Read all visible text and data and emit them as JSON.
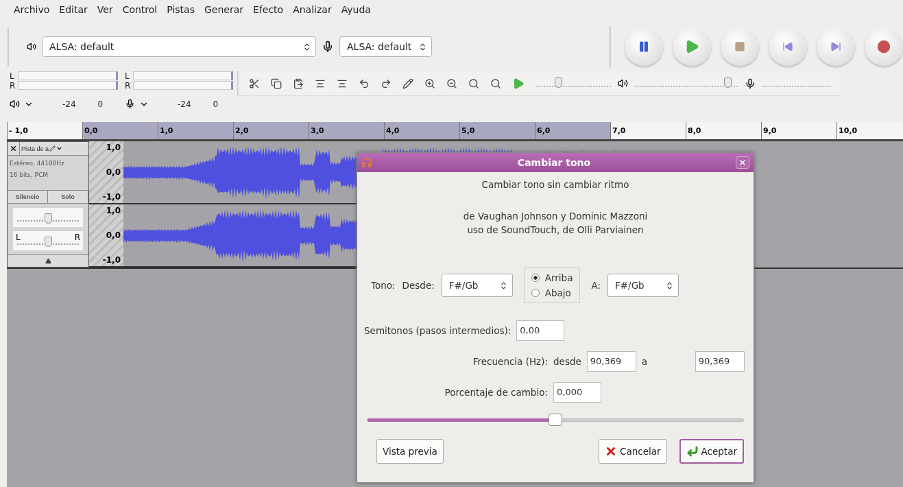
{
  "menu": [
    "Archivo",
    "Editar",
    "Ver",
    "Control",
    "Pistas",
    "Generar",
    "Efecto",
    "Analizar",
    "Ayuda"
  ],
  "device_toolbar": {
    "playback_device": "ALSA: default",
    "recording_device": "ALSA: default"
  },
  "meters": [
    {
      "kind": "playback",
      "channels": [
        "L",
        "R"
      ],
      "scale": [
        "-24",
        "0"
      ]
    },
    {
      "kind": "recording",
      "channels": [
        "L",
        "R"
      ],
      "scale": [
        "-24",
        "0"
      ]
    }
  ],
  "mixer": {
    "play_speed": {
      "level": 0.3
    },
    "playback_volume": {
      "level": 0.9
    }
  },
  "ruler": {
    "ticks": [
      {
        "label": "- 1,0",
        "selected": false
      },
      {
        "label": "0,0",
        "selected": true
      },
      {
        "label": "1,0",
        "selected": true
      },
      {
        "label": "2,0",
        "selected": true
      },
      {
        "label": "3,0",
        "selected": true
      },
      {
        "label": "4,0",
        "selected": true
      },
      {
        "label": "5,0",
        "selected": true
      },
      {
        "label": "6,0",
        "selected": true
      },
      {
        "label": "7,0",
        "selected": false
      },
      {
        "label": "8,0",
        "selected": false
      },
      {
        "label": "9,0",
        "selected": false
      },
      {
        "label": "10,0",
        "selected": false
      }
    ]
  },
  "track": {
    "name": "Pista de a",
    "info": [
      "Estéreo, 44100Hz",
      "16 bits, PCM"
    ],
    "buttons": [
      "Silencio",
      "Solo"
    ],
    "gain": {
      "level": 0.5
    },
    "pan": {
      "left": "L",
      "right": "R",
      "level": 0.5
    },
    "channels": [
      {
        "scale": [
          "1,0",
          "0,0",
          "-1,0"
        ]
      },
      {
        "scale": [
          "1,0",
          "0,0",
          "-1,0"
        ]
      }
    ]
  },
  "dialog": {
    "title": "Cambiar tono",
    "heading": "Cambiar tono sin cambiar ritmo",
    "credits": [
      "de Vaughan Johnson y Dominic Mazzoni",
      "uso de SoundTouch, de Olli Parviainen"
    ],
    "pitch": {
      "label": "Tono:",
      "from_label": "Desde:",
      "from_value": "F#/Gb",
      "to_label": "A:",
      "to_value": "F#/Gb",
      "directions": [
        {
          "label": "Arriba",
          "selected": true
        },
        {
          "label": "Abajo",
          "selected": false
        }
      ]
    },
    "semitones": {
      "label": "Semitonos (pasos intermedios):",
      "value": "0,00"
    },
    "frequency": {
      "label": "Frecuencia (Hz):",
      "from_label": "desde",
      "from_value": "90,369",
      "to_label": "a",
      "to_value": "90,369"
    },
    "percent": {
      "label": "Porcentaje de cambio:",
      "value": "0,000"
    },
    "slider": {
      "level": 0.5
    },
    "buttons": [
      {
        "label": "Vista previa",
        "kind": "preview",
        "default": false
      },
      {
        "label": "Cancelar",
        "kind": "cancel",
        "default": false
      },
      {
        "label": "Aceptar",
        "kind": "ok",
        "default": true
      }
    ]
  }
}
